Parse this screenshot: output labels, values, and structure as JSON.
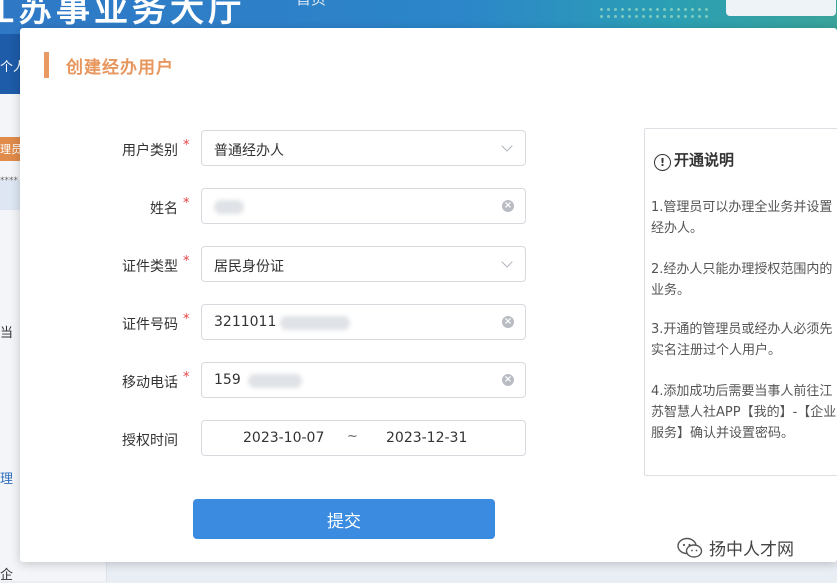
{
  "background": {
    "header_title": "江苏事业务大厅",
    "header_nav": "首页",
    "left_items": [
      "个人",
      "理员",
      "****",
      "当",
      "理",
      "企"
    ]
  },
  "dialog": {
    "title": "创建经办用户",
    "required_mark": "*",
    "fields": [
      {
        "label": "用户类别",
        "value": "普通经办人",
        "control": "select"
      },
      {
        "label": "姓名",
        "value": "",
        "control": "input"
      },
      {
        "label": "证件类型",
        "value": "居民身份证",
        "control": "select"
      },
      {
        "label": "证件号码",
        "value": "3211011",
        "control": "input"
      },
      {
        "label": "移动电话",
        "value": "159",
        "control": "input"
      }
    ],
    "auth_time": {
      "label": "授权时间",
      "start": "2023-10-07",
      "separator": "~",
      "end": "2023-12-31"
    },
    "submit_label": "提交"
  },
  "info_panel": {
    "icon": "!",
    "title": "开通说明",
    "items": [
      "1.管理员可以办理全业务并设置经办人。",
      "2.经办人只能办理授权范围内的业务。",
      "3.开通的管理员或经办人必须先实名注册过个人用户。",
      "4.添加成功后需要当事人前往江苏智慧人社APP【我的】-【企业服务】确认并设置密码。"
    ]
  },
  "watermark": {
    "text": "扬中人才网",
    "icon": "wechat-icon"
  },
  "colors": {
    "accent_orange": "#e7965d",
    "primary_blue": "#3b8be0",
    "required_red": "#e44141"
  }
}
